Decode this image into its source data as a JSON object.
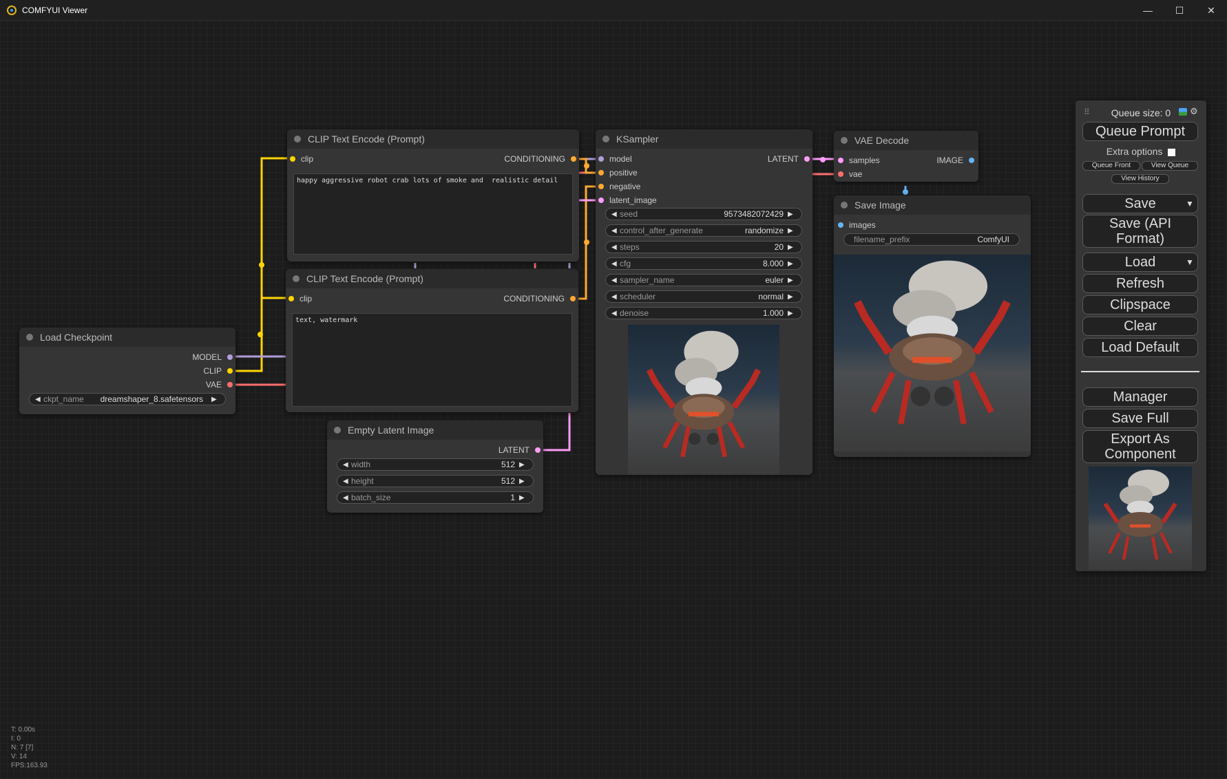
{
  "window": {
    "title": "COMFYUI Viewer",
    "minimize": "—",
    "maximize": "☐",
    "close": "✕"
  },
  "nodes": {
    "load_checkpoint": {
      "title": "Load Checkpoint",
      "outputs": [
        "MODEL",
        "CLIP",
        "VAE"
      ],
      "widget": {
        "label": "ckpt_name",
        "value": "dreamshaper_8.safetensors"
      }
    },
    "clip_pos": {
      "title": "CLIP Text Encode (Prompt)",
      "input": "clip",
      "output": "CONDITIONING",
      "text": "happy aggressive robot crab lots of smoke and  realistic detail"
    },
    "clip_neg": {
      "title": "CLIP Text Encode (Prompt)",
      "input": "clip",
      "output": "CONDITIONING",
      "text": "text, watermark"
    },
    "empty_latent": {
      "title": "Empty Latent Image",
      "output": "LATENT",
      "widgets": [
        {
          "label": "width",
          "value": "512"
        },
        {
          "label": "height",
          "value": "512"
        },
        {
          "label": "batch_size",
          "value": "1"
        }
      ]
    },
    "ksampler": {
      "title": "KSampler",
      "inputs": [
        "model",
        "positive",
        "negative",
        "latent_image"
      ],
      "output": "LATENT",
      "widgets": [
        {
          "label": "seed",
          "value": "9573482072429"
        },
        {
          "label": "control_after_generate",
          "value": "randomize"
        },
        {
          "label": "steps",
          "value": "20"
        },
        {
          "label": "cfg",
          "value": "8.000"
        },
        {
          "label": "sampler_name",
          "value": "euler"
        },
        {
          "label": "scheduler",
          "value": "normal"
        },
        {
          "label": "denoise",
          "value": "1.000"
        }
      ]
    },
    "vae_decode": {
      "title": "VAE Decode",
      "inputs": [
        "samples",
        "vae"
      ],
      "output": "IMAGE"
    },
    "save_image": {
      "title": "Save Image",
      "input": "images",
      "widget": {
        "label": "filename_prefix",
        "value": "ComfyUI"
      }
    }
  },
  "menu": {
    "queue_size": "Queue size: 0",
    "queue_prompt": "Queue Prompt",
    "extra_options": "Extra options",
    "queue_front": "Queue Front",
    "view_queue": "View Queue",
    "view_history": "View History",
    "save": "Save",
    "save_api": "Save (API Format)",
    "load": "Load",
    "refresh": "Refresh",
    "clipspace": "Clipspace",
    "clear": "Clear",
    "load_default": "Load Default",
    "manager": "Manager",
    "save_full": "Save Full",
    "export_component": "Export As Component"
  },
  "stats": [
    "T: 0.00s",
    "I: 0",
    "N: 7 [7]",
    "V: 14",
    "FPS:163.93"
  ],
  "colors": {
    "clip": "#ffd500",
    "model": "#b39ddb",
    "vae": "#ff6e6e",
    "conditioning": "#ffa931",
    "latent": "#ff9cf9",
    "image": "#64b5f6"
  }
}
